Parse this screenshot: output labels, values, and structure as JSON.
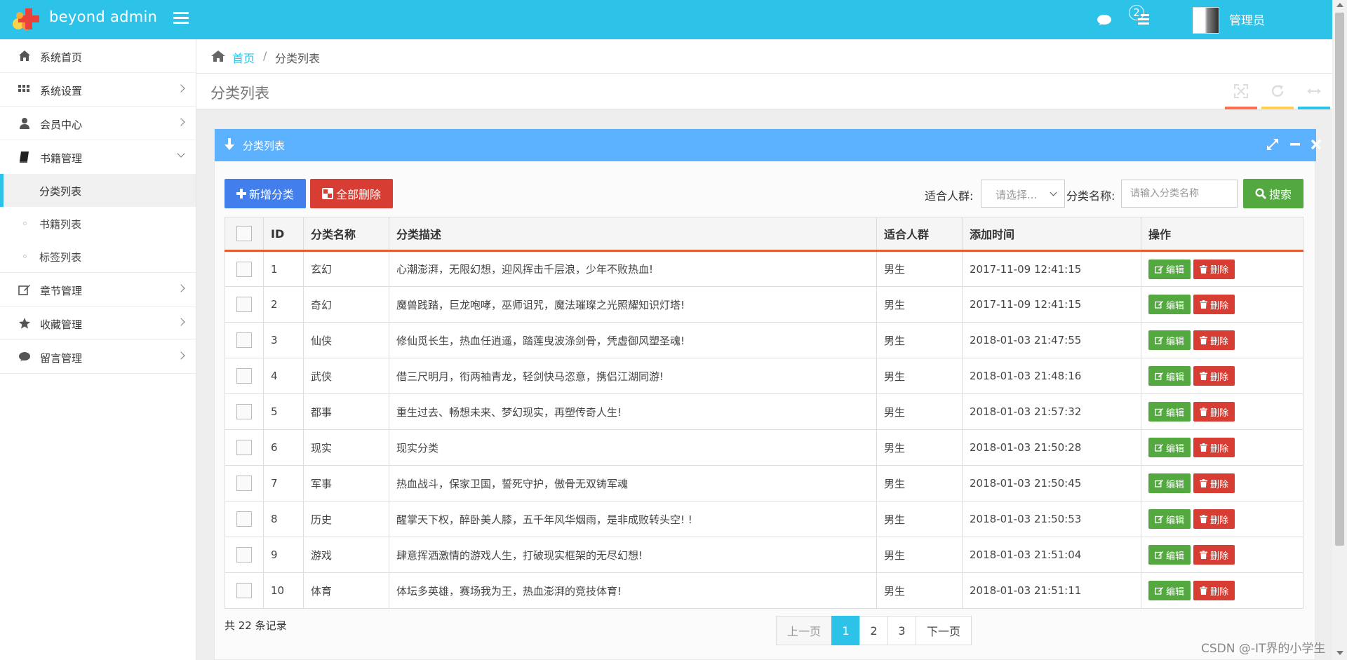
{
  "app": {
    "logo_text": "beyond admin",
    "user_name": "管理员",
    "tasks_badge": "2"
  },
  "sidebar": {
    "items": [
      {
        "label": "系统首页",
        "icon": "home-icon"
      },
      {
        "label": "系统设置",
        "icon": "grid-icon"
      },
      {
        "label": "会员中心",
        "icon": "user-icon"
      },
      {
        "label": "书籍管理",
        "icon": "book-icon"
      },
      {
        "label": "章节管理",
        "icon": "edit-icon"
      },
      {
        "label": "收藏管理",
        "icon": "star-icon"
      },
      {
        "label": "留言管理",
        "icon": "comment-icon"
      }
    ],
    "sub_items": [
      {
        "label": "分类列表"
      },
      {
        "label": "书籍列表"
      },
      {
        "label": "标签列表"
      }
    ]
  },
  "breadcrumb": {
    "home": "首页",
    "separator": "/",
    "current": "分类列表"
  },
  "page": {
    "title": "分类列表"
  },
  "widget": {
    "title": "分类列表"
  },
  "toolbar": {
    "add_label": "新增分类",
    "delete_all_label": "全部删除",
    "audience_label": "适合人群:",
    "audience_placeholder": "请选择...",
    "name_label": "分类名称:",
    "name_placeholder": "请输入分类名称",
    "search_label": "搜索"
  },
  "table": {
    "headers": [
      "ID",
      "分类名称",
      "分类描述",
      "适合人群",
      "添加时间",
      "操作"
    ],
    "edit_label": "编辑",
    "delete_label": "删除",
    "rows": [
      {
        "id": "1",
        "name": "玄幻",
        "desc": "心潮澎湃，无限幻想，迎风挥击千层浪，少年不败热血!",
        "audience": "男生",
        "time": "2017-11-09 12:41:15"
      },
      {
        "id": "2",
        "name": "奇幻",
        "desc": "魔兽践踏，巨龙咆哮，巫师诅咒，魔法璀璨之光照耀知识灯塔!",
        "audience": "男生",
        "time": "2017-11-09 12:41:15"
      },
      {
        "id": "3",
        "name": "仙侠",
        "desc": "修仙觅长生，热血任逍遥，踏莲曳波涤剑骨，凭虚御风塑圣魂!",
        "audience": "男生",
        "time": "2018-01-03 21:47:55"
      },
      {
        "id": "4",
        "name": "武侠",
        "desc": "借三尺明月，衔两袖青龙，轻剑快马恣意，携侣江湖同游!",
        "audience": "男生",
        "time": "2018-01-03 21:48:16"
      },
      {
        "id": "5",
        "name": "都事",
        "desc": "重生过去、畅想未来、梦幻现实，再塑传奇人生!",
        "audience": "男生",
        "time": "2018-01-03 21:57:32"
      },
      {
        "id": "6",
        "name": "现实",
        "desc": "现实分类",
        "audience": "男生",
        "time": "2018-01-03 21:50:28"
      },
      {
        "id": "7",
        "name": "军事",
        "desc": "热血战斗，保家卫国，誓死守护，傲骨无双铸军魂",
        "audience": "男生",
        "time": "2018-01-03 21:50:45"
      },
      {
        "id": "8",
        "name": "历史",
        "desc": "醒掌天下权，醉卧美人膝，五千年风华烟雨，是非成败转头空! !",
        "audience": "男生",
        "time": "2018-01-03 21:50:53"
      },
      {
        "id": "9",
        "name": "游戏",
        "desc": "肆意挥洒激情的游戏人生，打破现实框架的无尽幻想!",
        "audience": "男生",
        "time": "2018-01-03 21:51:04"
      },
      {
        "id": "10",
        "name": "体育",
        "desc": "体坛多英雄，赛场我为王，热血澎湃的竞技体育!",
        "audience": "男生",
        "time": "2018-01-03 21:51:11"
      }
    ]
  },
  "footer": {
    "total_text": "共 22 条记录",
    "pager": {
      "prev": "上一页",
      "pages": [
        "1",
        "2",
        "3"
      ],
      "active": "1",
      "next": "下一页"
    }
  },
  "watermark": "CSDN @-IT界的小学生",
  "colors": {
    "topbar": "#2dc3e8",
    "widget_header": "#5db2ff",
    "primary": "#427fed",
    "danger": "#d73d32",
    "success": "#53a93f",
    "table_accent": "#e25d33"
  }
}
